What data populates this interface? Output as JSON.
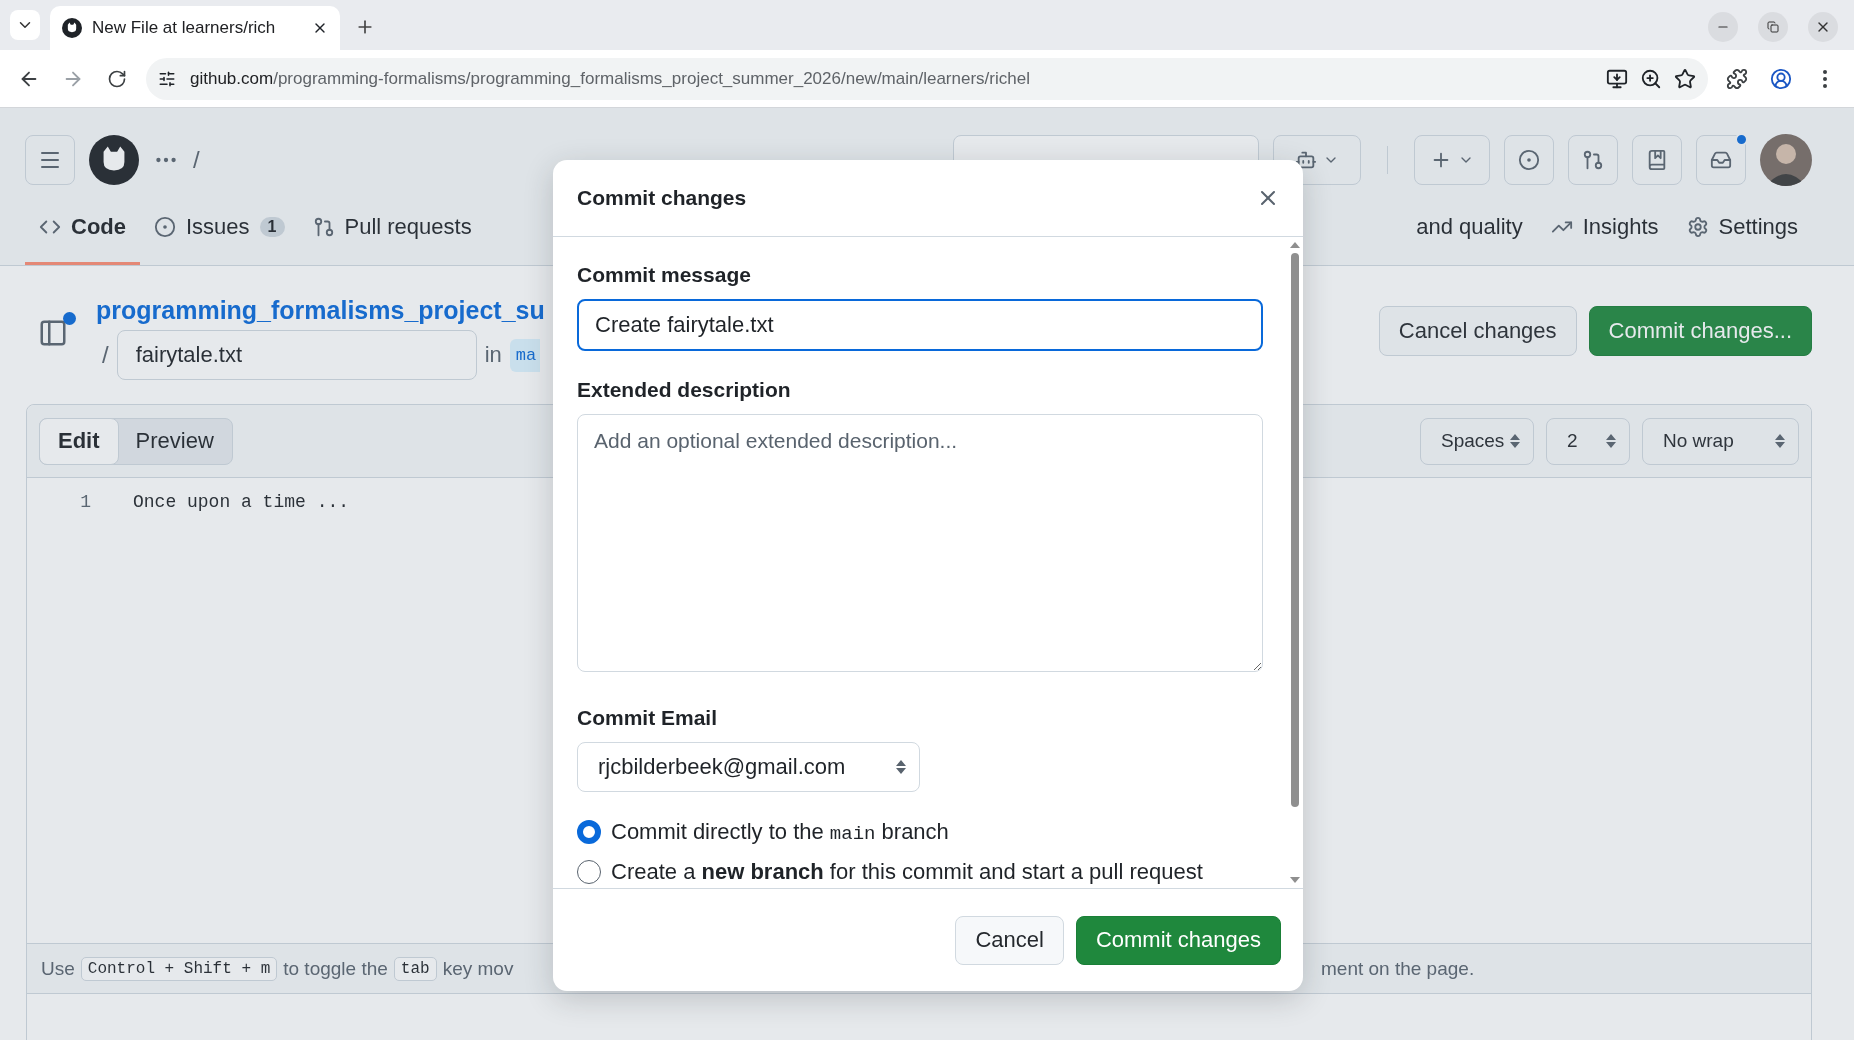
{
  "browser": {
    "tab_title": "New File at learners/rich",
    "url_host": "github.com",
    "url_path": "/programming-formalisms/programming_formalisms_project_summer_2026/new/main/learners/richel"
  },
  "header": {
    "separator": "/",
    "inbox_unread": true
  },
  "nav_left": [
    {
      "label": "Code",
      "selected": true
    },
    {
      "label": "Issues",
      "count": "1",
      "selected": false
    },
    {
      "label": "Pull requests",
      "selected": false
    }
  ],
  "nav_right": [
    {
      "label": "and quality",
      "selected": false
    },
    {
      "label": "Insights",
      "selected": false
    },
    {
      "label": "Settings",
      "selected": false
    }
  ],
  "file_path": {
    "tree_unread": true,
    "repo_link": "programming_formalisms_project_su",
    "separator": "/",
    "file_name": "fairytale.txt",
    "in": "in",
    "branch": "ma"
  },
  "actions": [
    {
      "label": "Cancel changes",
      "kind": "secondary"
    },
    {
      "label": "Commit changes...",
      "kind": "primary"
    }
  ],
  "editor": {
    "tabs": [
      {
        "label": "Edit",
        "selected": true
      },
      {
        "label": "Preview",
        "selected": false
      }
    ],
    "options": [
      "Spaces",
      "2",
      "No wrap"
    ],
    "lines": [
      {
        "number": "1",
        "text": "Once upon a time ..."
      }
    ],
    "hint_left": [
      {
        "kind": "text",
        "text": "Use"
      },
      {
        "kind": "key",
        "text": "Control + Shift + m"
      },
      {
        "kind": "text",
        "text": "to toggle the"
      },
      {
        "kind": "key",
        "text": "tab"
      },
      {
        "kind": "text",
        "text": "key mov"
      }
    ],
    "hint_right": "ment on the page."
  },
  "dialog": {
    "title": "Commit changes",
    "message_label": "Commit message",
    "message_value": "Create fairytale.txt",
    "description_label": "Extended description",
    "description_placeholder": "Add an optional extended description...",
    "email_label": "Commit Email",
    "email_value": "rjcbilderbeek@gmail.com",
    "branch_options": [
      {
        "selected": true,
        "parts": [
          {
            "kind": "text",
            "text": "Commit directly to the "
          },
          {
            "kind": "code",
            "text": "main"
          },
          {
            "kind": "text",
            "text": " branch"
          }
        ]
      },
      {
        "selected": false,
        "parts": [
          {
            "kind": "text",
            "text": "Create a **new branch** for this commit and start a pull request"
          }
        ]
      }
    ],
    "buttons": [
      {
        "label": "Cancel",
        "kind": "secondary"
      },
      {
        "label": "Commit changes",
        "kind": "primary"
      }
    ]
  }
}
